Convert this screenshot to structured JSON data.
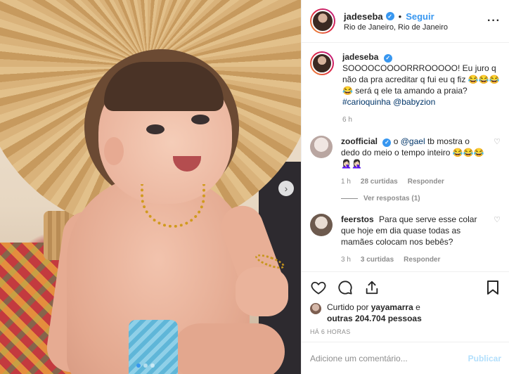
{
  "photo": {
    "alt": "Bebê sorrindo com chapéu de palha na praia",
    "carousel_count": 3,
    "carousel_active_index": 0
  },
  "header": {
    "username": "jadeseba",
    "separator": "•",
    "follow_label": "Seguir",
    "location": "Rio de Janeiro, Rio de Janeiro"
  },
  "caption": {
    "username": "jadeseba",
    "text": "SOOOOCOOOORRROOOOO! Eu juro q não da pra acreditar q fui eu q fiz 😂😂😂😂 será q ele ta amando a praia?",
    "tag1": "#carioquinha",
    "tag2": "@babyzion",
    "time": "6 h"
  },
  "comments": [
    {
      "username": "zoofficial",
      "prefix": "o",
      "mention": "@gael",
      "text": "tb mostra o dedo do meio o tempo inteiro 😂😂😂🤦🏻‍♀️🤦🏻‍♀️",
      "time": "1 h",
      "likes": "28 curtidas",
      "reply_label": "Responder",
      "view_replies": "Ver respostas (1)"
    },
    {
      "username": "feerstos",
      "text": "Para que serve esse colar que hoje em dia quase todas as mamães colocam nos bebês?",
      "time": "3 h",
      "likes": "3 curtidas",
      "reply_label": "Responder"
    }
  ],
  "likes": {
    "prefix": "Curtido por",
    "first_user": "yayamarra",
    "connector": "e",
    "others": "outras 204.704 pessoas"
  },
  "posted_ago": "HÁ 6 HORAS",
  "add_comment": {
    "placeholder": "Adicione um comentário...",
    "publish_label": "Publicar"
  },
  "colors": {
    "accent": "#3897f0",
    "tag": "#003569",
    "muted": "#8e8e8e",
    "publish_disabled": "#b2dffc"
  },
  "icons": [
    "more-options-icon",
    "verified-icon",
    "heart-icon",
    "comment-icon",
    "share-icon",
    "bookmark-icon",
    "next-arrow-icon"
  ]
}
